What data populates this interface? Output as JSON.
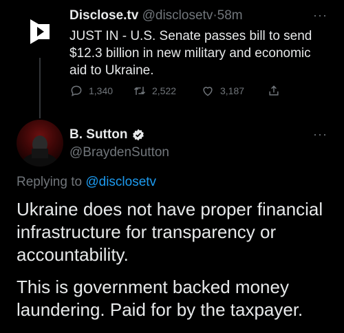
{
  "parent_tweet": {
    "display_name": "Disclose.tv",
    "handle": "@disclosetv",
    "separator": "·",
    "time": "58m",
    "text": "JUST IN - U.S. Senate passes bill to send $12.3 billion in new military and economic aid to Ukraine.",
    "more": "···",
    "avatar_icon": "disclose-logo-icon",
    "actions": {
      "replies": "1,340",
      "retweets": "2,522",
      "likes": "3,187"
    }
  },
  "reply_tweet": {
    "display_name": "B. Sutton",
    "verified": true,
    "handle": "@BraydenSutton",
    "more": "···",
    "replying_prefix": "Replying to",
    "replying_to": "@disclosetv",
    "paragraph1": "Ukraine does not have proper financial infrastructure for transparency or accountability.",
    "paragraph2": "This is government backed money laundering. Paid for by the taxpayer."
  },
  "colors": {
    "background": "#000000",
    "text": "#e7e9ea",
    "muted": "#71767b",
    "accent": "#1d9bf0"
  }
}
